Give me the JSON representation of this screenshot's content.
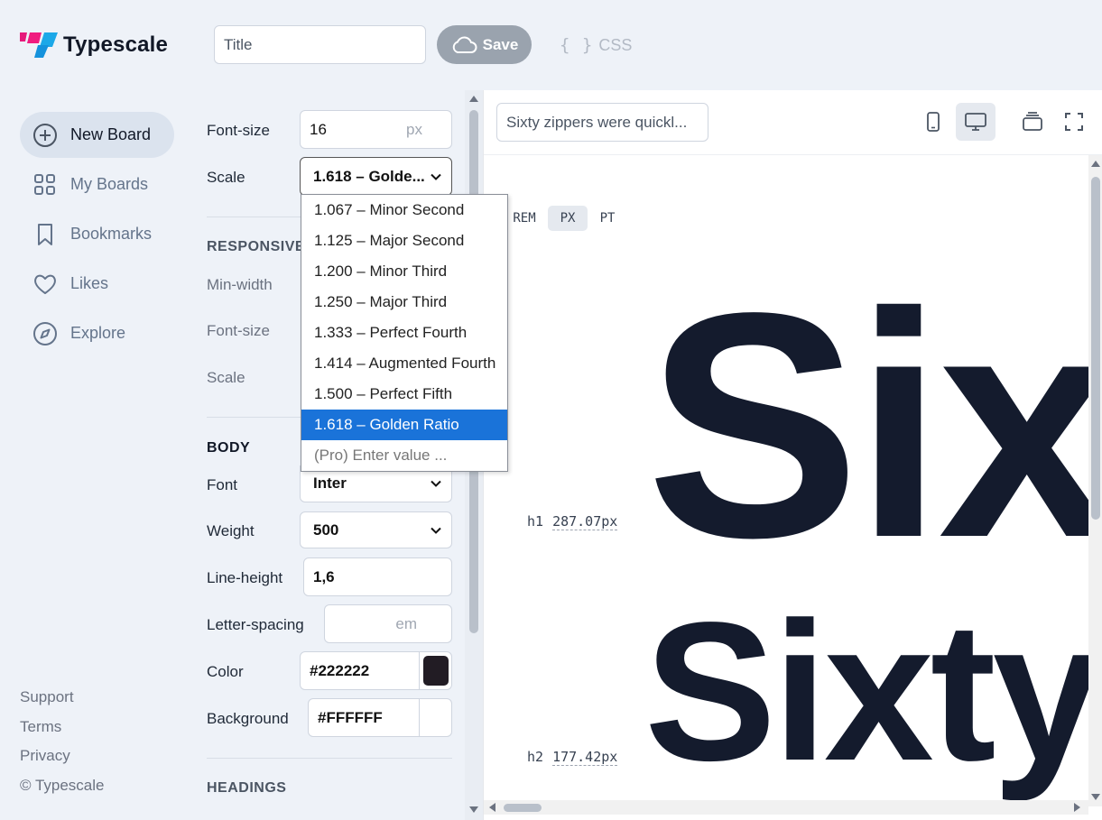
{
  "header": {
    "app_name": "Typescale",
    "title_placeholder": "Title",
    "save_label": "Save",
    "css_label": "CSS",
    "css_braces": "{ }"
  },
  "sidebar": {
    "items": [
      {
        "label": "New Board",
        "icon": "plus-circle-icon",
        "active": true
      },
      {
        "label": "My Boards",
        "icon": "grid-icon",
        "active": false
      },
      {
        "label": "Bookmarks",
        "icon": "bookmark-icon",
        "active": false
      },
      {
        "label": "Likes",
        "icon": "heart-icon",
        "active": false
      },
      {
        "label": "Explore",
        "icon": "compass-icon",
        "active": false
      }
    ],
    "footer": [
      "Support",
      "Terms",
      "Privacy",
      "© Typescale"
    ]
  },
  "settings": {
    "font_size_label": "Font-size",
    "font_size_value": "16",
    "font_size_unit": "px",
    "scale_label": "Scale",
    "scale_value": "1.618 – Golde...",
    "responsive": {
      "heading": "RESPONSIVE",
      "min_width_label": "Min-width",
      "font_size_label": "Font-size",
      "scale_label": "Scale"
    },
    "body": {
      "heading": "BODY",
      "font_label": "Font",
      "font_value": "Inter",
      "weight_label": "Weight",
      "weight_value": "500",
      "line_height_label": "Line-height",
      "line_height_value": "1,6",
      "letter_spacing_label": "Letter-spacing",
      "letter_spacing_value": "",
      "letter_spacing_unit": "em",
      "color_label": "Color",
      "color_value": "#222222",
      "color_swatch": "#221c24",
      "background_label": "Background",
      "background_value": "#FFFFFF",
      "background_swatch": "#ffffff"
    },
    "headings_label": "HEADINGS"
  },
  "scale_dropdown": {
    "options": [
      "1.067 – Minor Second",
      "1.125 – Major Second",
      "1.200 – Minor Third",
      "1.250 – Major Third",
      "1.333 – Perfect Fourth",
      "1.414 – Augmented Fourth",
      "1.500 – Perfect Fifth",
      "1.618 – Golden Ratio",
      "(Pro) Enter value ..."
    ],
    "selected_index": 7
  },
  "preview": {
    "sample_text": "Sixty zippers were quickl...",
    "units": [
      "REM",
      "PX",
      "PT"
    ],
    "active_unit": "PX",
    "rows": [
      {
        "tag": "h1",
        "size": "287.07px",
        "text": "Sixty"
      },
      {
        "tag": "h2",
        "size": "177.42px",
        "text": "Sixty"
      }
    ]
  },
  "colors": {
    "accent": "#1a73d9",
    "text_dark": "#141b2d",
    "save_bg": "#9aa3ae"
  }
}
